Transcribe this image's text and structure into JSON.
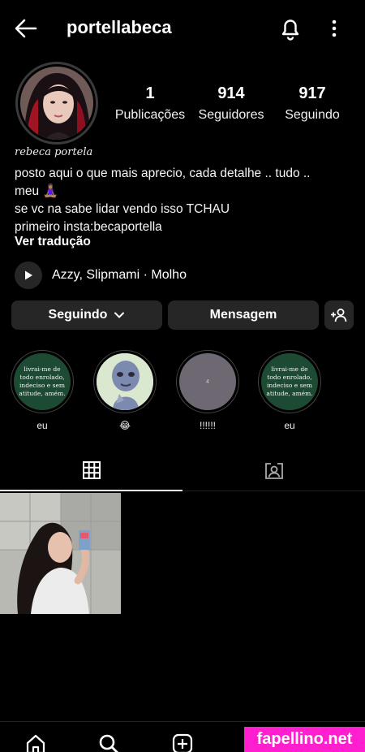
{
  "header": {
    "username": "portellabeca"
  },
  "profile": {
    "stats": [
      {
        "value": "1",
        "label": "Publicações"
      },
      {
        "value": "914",
        "label": "Seguidores"
      },
      {
        "value": "917",
        "label": "Seguindo"
      }
    ],
    "display_name": "rebeca portela",
    "bio_lines": [
      "posto aqui o que mais aprecio, cada detalhe .. tudo ..",
      "meu 🧘🏽‍♀️",
      "se vc na sabe lidar vendo isso TCHAU",
      "primeiro insta:becaportella"
    ],
    "translate_link": "Ver tradução"
  },
  "music": {
    "text": "Azzy, Slipmami · Molho"
  },
  "actions": {
    "following": "Seguindo",
    "message": "Mensagem"
  },
  "highlights": [
    {
      "label": "eu",
      "text": "livrai-me de todo enrolado, indeciso e sem atitude, amém."
    },
    {
      "label": "😂",
      "text": ""
    },
    {
      "label": "!!!!!!",
      "text": "4"
    },
    {
      "label": "eu",
      "text": "livrai-me de todo enrolado, indeciso e sem atitude, amém."
    }
  ],
  "watermark": "fapellino.net",
  "colors": {
    "background": "#000000",
    "button": "#262626",
    "highlight_green": "#1d4a33",
    "watermark": "#ff1fcf"
  }
}
